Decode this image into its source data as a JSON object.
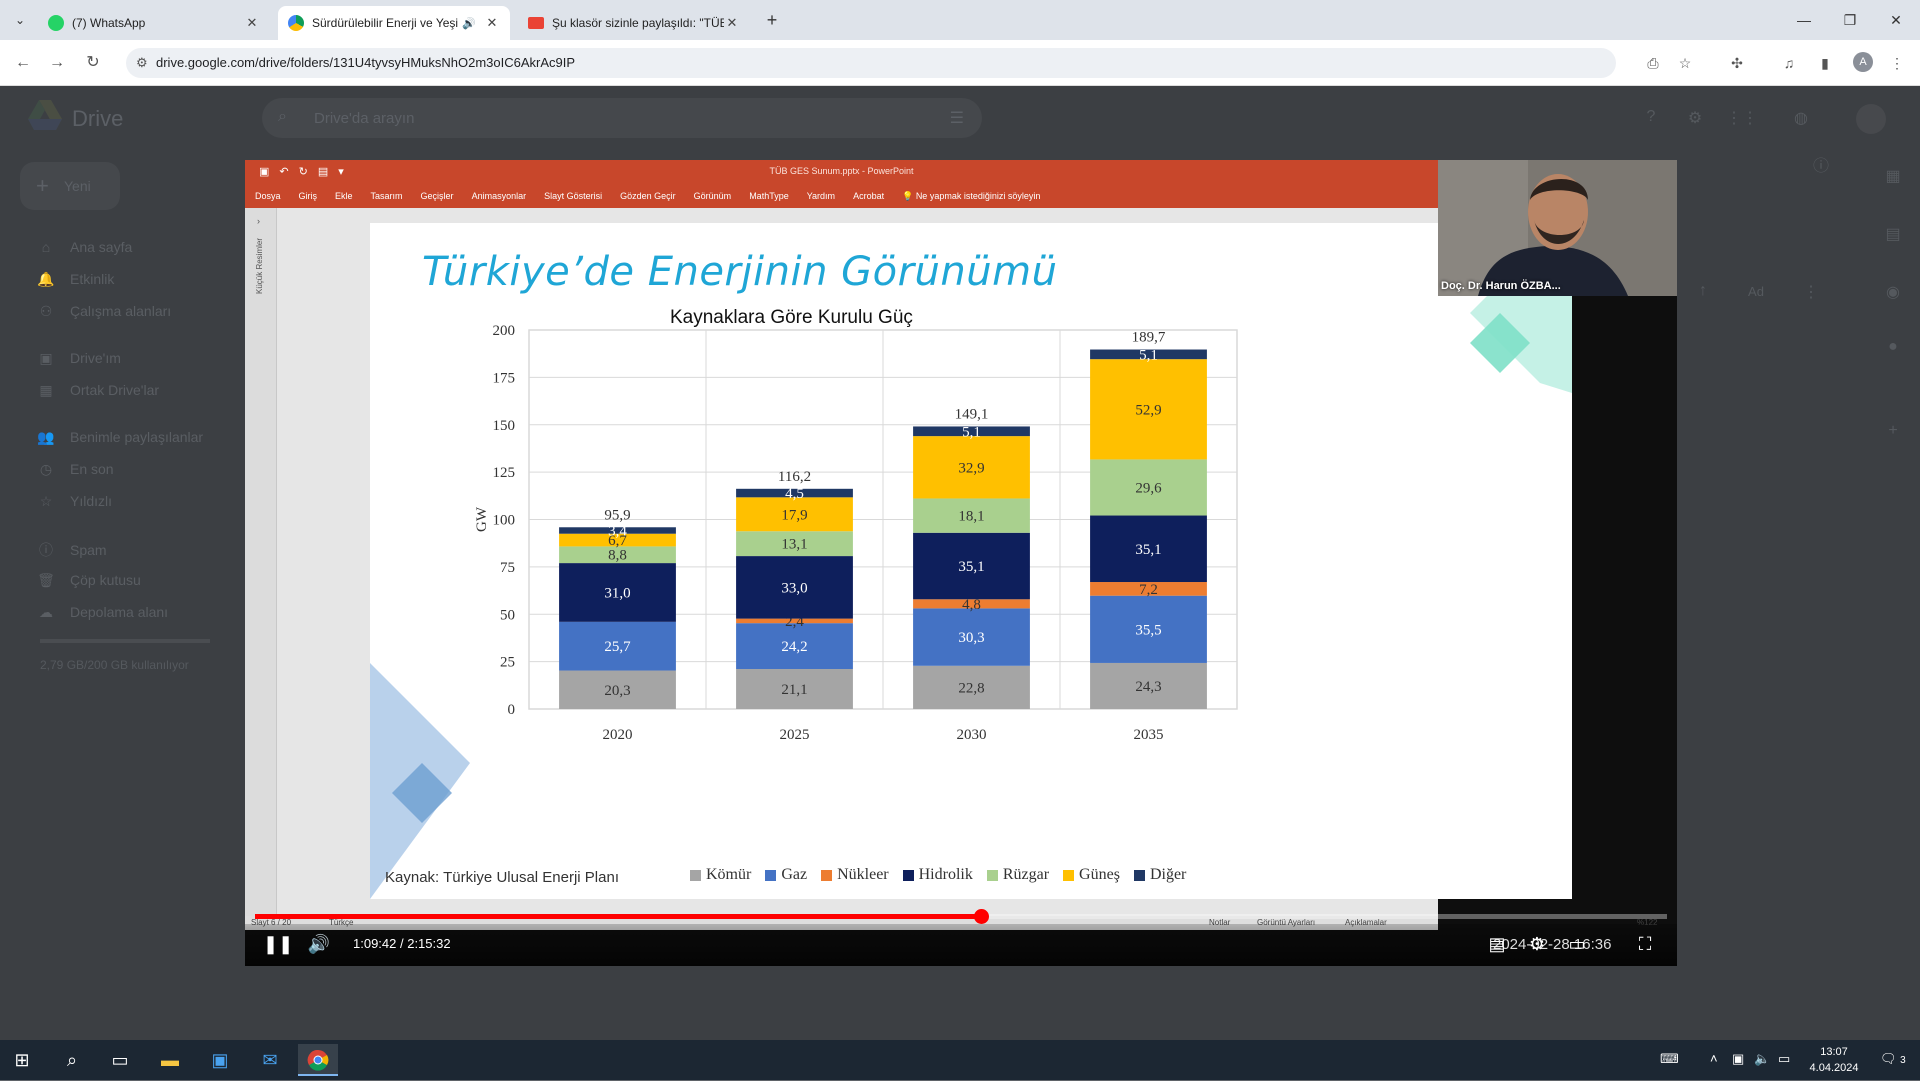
{
  "browser": {
    "tabs": [
      {
        "label": "(7) WhatsApp",
        "favicon_color": "#25d366",
        "active": false
      },
      {
        "label": "Sürdürülebilir Enerji ve Yeşi",
        "favicon_color": "#1fa463",
        "active": true
      },
      {
        "label": "Şu klasör sizinle paylaşıldı: \"TÜB",
        "favicon_color": "#ea4335",
        "active": false
      }
    ],
    "new_tab_glyph": "+",
    "url": "drive.google.com/drive/folders/131U4tyvsyHMuksNhO2m3oIC6AkrAc9IP",
    "avatar_letter": "A"
  },
  "drive": {
    "logo_text": "Drive",
    "search_placeholder": "Drive'da arayın",
    "new_button": "Yeni",
    "nav": [
      {
        "icon": "⌂",
        "label": "Ana sayfa"
      },
      {
        "icon": "🔔",
        "label": "Etkinlik"
      },
      {
        "icon": "⚇",
        "label": "Çalışma alanları"
      },
      {
        "icon": "▣",
        "label": "Drive'ım"
      },
      {
        "icon": "▦",
        "label": "Ortak Drive'lar"
      },
      {
        "icon": "👥",
        "label": "Benimle paylaşılanlar"
      },
      {
        "icon": "◷",
        "label": "En son"
      },
      {
        "icon": "☆",
        "label": "Yıldızlı"
      },
      {
        "icon": "ⓘ",
        "label": "Spam"
      },
      {
        "icon": "🗑",
        "label": "Çöp kutusu"
      },
      {
        "icon": "☁",
        "label": "Depolama alanı"
      }
    ],
    "storage_text": "2,79 GB/200 GB kullanılıyor",
    "sort_label": "Ad"
  },
  "powerpoint": {
    "doc_title": "TÜB GES Sunum.pptx - PowerPoint",
    "ribbon": [
      "Dosya",
      "Giriş",
      "Ekle",
      "Tasarım",
      "Geçişler",
      "Animasyonlar",
      "Slayt Gösterisi",
      "Gözden Geçir",
      "Görünüm",
      "MathType",
      "Yardım",
      "Acrobat",
      "Ne yapmak istediğinizi söyleyin"
    ],
    "thumbnails_label": "Küçük Resimler",
    "status_left": "Slayt 6 / 20",
    "status_lang": "Türkçe",
    "status_right": [
      "Notlar",
      "Görüntü Ayarları",
      "Açıklamalar"
    ],
    "zoom": "%122"
  },
  "slide": {
    "title": "Türkiye’de Enerjinin Görünümü",
    "source": "Kaynak: Türkiye Ulusal Enerji Planı"
  },
  "chart_data": {
    "type": "bar",
    "stacked": true,
    "title": "Kaynaklara Göre Kurulu Güç",
    "ylabel": "GW",
    "xlabel": "",
    "ylim": [
      0,
      200
    ],
    "yticks": [
      0,
      25,
      50,
      75,
      100,
      125,
      150,
      175,
      200
    ],
    "categories": [
      "2020",
      "2025",
      "2030",
      "2035"
    ],
    "totals": [
      "95,9",
      "116,2",
      "149,1",
      "189,7"
    ],
    "legend_position": "bottom",
    "grid": true,
    "series": [
      {
        "name": "Kömür",
        "color": "#a5a5a5",
        "values": [
          20.3,
          21.1,
          22.8,
          24.3
        ],
        "labels": [
          "20,3",
          "21,1",
          "22,8",
          "24,3"
        ]
      },
      {
        "name": "Gaz",
        "color": "#4472c4",
        "values": [
          25.7,
          24.2,
          30.3,
          35.5
        ],
        "labels": [
          "25,7",
          "24,2",
          "30,3",
          "35,5"
        ]
      },
      {
        "name": "Nükleer",
        "color": "#ed7d31",
        "values": [
          0,
          2.4,
          4.8,
          7.2
        ],
        "labels": [
          "",
          "2,4",
          "4,8",
          "7,2"
        ]
      },
      {
        "name": "Hidrolik",
        "color": "#0e1f5c",
        "values": [
          31.0,
          33.0,
          35.1,
          35.1
        ],
        "labels": [
          "31,0",
          "33,0",
          "35,1",
          "35,1"
        ]
      },
      {
        "name": "Rüzgar",
        "color": "#a9d08e",
        "values": [
          8.8,
          13.1,
          18.1,
          29.6
        ],
        "labels": [
          "8,8",
          "13,1",
          "18,1",
          "29,6"
        ]
      },
      {
        "name": "Güneş",
        "color": "#ffc000",
        "values": [
          6.7,
          17.9,
          32.9,
          52.9
        ],
        "labels": [
          "6,7",
          "17,9",
          "32,9",
          "52,9"
        ]
      },
      {
        "name": "Diğer",
        "color": "#203864",
        "values": [
          3.4,
          4.5,
          5.1,
          5.1
        ],
        "labels": [
          "3,4",
          "4,5",
          "5,1",
          "5,1"
        ]
      }
    ]
  },
  "webcam": {
    "name": "Doç. Dr. Harun ÖZBA..."
  },
  "player": {
    "time": "1:09:42 / 2:15:32",
    "progress": 0.514,
    "overlay_date": "2024-02-28 16:36"
  },
  "taskbar": {
    "time": "13:07",
    "date": "4.04.2024",
    "notifications": "3"
  }
}
